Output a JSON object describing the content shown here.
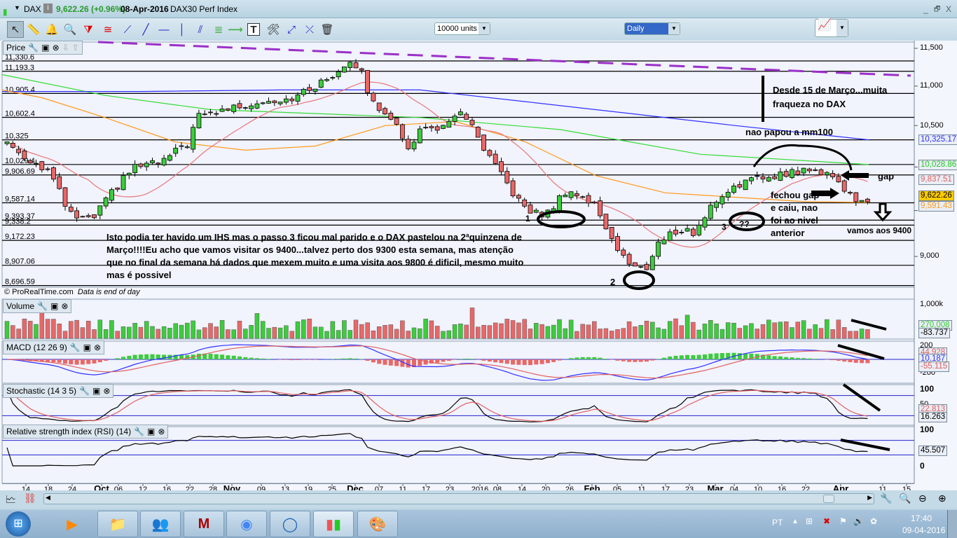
{
  "window": {
    "symbol": "DAX",
    "price": "9,622.26 (+0.96%)",
    "date": "08-Apr-2016",
    "name": "DAX30 Perf Index",
    "min": "_",
    "restore": "🗗",
    "close": "X"
  },
  "toolbar": {
    "units": "10000 units",
    "timeframe": "Daily"
  },
  "price_panel": {
    "title": "Price",
    "footer_brand": "© ProRealTime.com",
    "footer_note": "Data is end of day",
    "levels": [
      "11,330.6",
      "11,193.3",
      "10,905.4",
      "10,602.4",
      "10,325",
      "10,029.4",
      "9,906.69",
      "9,587.14",
      "9,393.37",
      "9,338.2",
      "9,172.23",
      "8,907.06",
      "8,696.59"
    ],
    "axis": [
      "11,500",
      "11,000",
      "10,500",
      "9,000"
    ],
    "badges": [
      {
        "text": "10,325.17",
        "color": "#3030ff"
      },
      {
        "text": "10,028.86",
        "color": "#33dd33"
      },
      {
        "text": "9,837.51",
        "color": "#e06060"
      },
      {
        "text": "9,622.26",
        "color": "#000000"
      },
      {
        "text": "9,591.43",
        "color": "#ff9a1a"
      }
    ]
  },
  "annotations": {
    "main_note": [
      "Isto podia ter havido um IHS mas o passo 3 ficou mal parido e o DAX pastelou na 2ªquinzena de",
      "Março!!!!Eu acho que vamos visitar os 9400...talvez perto dos 9300 esta semana, mas atenção",
      "que no final da semana há dados que mexem muito e uma visita aos 9800 é dificil, mesmo muito",
      "mas é possivel"
    ],
    "weakness": [
      "Desde 15 de Março...muita",
      "fraqueza no DAX"
    ],
    "mm100": "nao papou a mm100",
    "gap": "gap",
    "gap_closed": [
      "fechou gap",
      "e caiu, nao",
      "foi ao nivel",
      "anterior"
    ],
    "target": "vamos aos 9400",
    "step1": "1",
    "step2": "2",
    "step3": "3",
    "question": "??"
  },
  "volume": {
    "title": "Volume",
    "axis": "1,000k",
    "badges": [
      "270,008",
      "-83.737"
    ]
  },
  "macd": {
    "title": "MACD (12 26 9)",
    "axis": [
      "200",
      "-200"
    ],
    "badges": [
      "44.928",
      "10.187",
      "-55.115"
    ]
  },
  "stoch": {
    "title": "Stochastic (14 3 5)",
    "axis": [
      "100",
      "50"
    ],
    "badges": [
      "22.813",
      "16.263"
    ]
  },
  "rsi": {
    "title": "Relative strength index (RSI) (14)",
    "axis": [
      "100",
      "0"
    ],
    "badge": "45.507"
  },
  "xaxis": [
    "14",
    "18",
    "24",
    "Oct",
    "06",
    "12",
    "16",
    "22",
    "28",
    "Nov",
    "09",
    "13",
    "19",
    "25",
    "Dec",
    "07",
    "11",
    "17",
    "23",
    "2016",
    "08",
    "14",
    "20",
    "26",
    "Feb",
    "05",
    "11",
    "17",
    "23",
    "Mar",
    "04",
    "10",
    "16",
    "22",
    "Apr",
    "11",
    "15"
  ],
  "taskbar": {
    "lang": "PT",
    "time": "17:40",
    "date": "09-04-2016"
  },
  "colors": {
    "up": "#3ccc3c",
    "down": "#e86868",
    "ma_red": "#e87878",
    "ma_orange": "#ff9a1a",
    "ma_blue": "#3030ff",
    "ma_green": "#33dd33",
    "trend": "#9b30c8"
  },
  "chart_data": {
    "type": "candlestick",
    "title": "DAX30 Perf Index - Daily",
    "x_range": [
      "Sep 2015",
      "Apr 2016"
    ],
    "y_range": [
      8650,
      11550
    ],
    "close_path": [
      [
        "Sep-10",
        10300
      ],
      [
        "Sep-14",
        10150
      ],
      [
        "Sep-18",
        9950
      ],
      [
        "Sep-24",
        9450
      ],
      [
        "Sep-29",
        9380
      ],
      [
        "Oct-05",
        9700
      ],
      [
        "Oct-09",
        10000
      ],
      [
        "Oct-16",
        10050
      ],
      [
        "Oct-21",
        10300
      ],
      [
        "Oct-22",
        10600
      ],
      [
        "Oct-28",
        10700
      ],
      [
        "Nov-06",
        10800
      ],
      [
        "Nov-13",
        10850
      ],
      [
        "Nov-23",
        11100
      ],
      [
        "Nov-30",
        11350
      ],
      [
        "Dec-01",
        11200
      ],
      [
        "Dec-03",
        10800
      ],
      [
        "Dec-09",
        10600
      ],
      [
        "Dec-14",
        10200
      ],
      [
        "Dec-16",
        10450
      ],
      [
        "Dec-23",
        10500
      ],
      [
        "Dec-29",
        10700
      ],
      [
        "Jan-05",
        10200
      ],
      [
        "Jan-11",
        9850
      ],
      [
        "Jan-15",
        9500
      ],
      [
        "Jan-20",
        9450
      ],
      [
        "Jan-26",
        9750
      ],
      [
        "Feb-01",
        9550
      ],
      [
        "Feb-05",
        9100
      ],
      [
        "Feb-08",
        8900
      ],
      [
        "Feb-11",
        8850
      ],
      [
        "Feb-16",
        9150
      ],
      [
        "Feb-19",
        9300
      ],
      [
        "Feb-24",
        9250
      ],
      [
        "Mar-01",
        9600
      ],
      [
        "Mar-04",
        9800
      ],
      [
        "Mar-10",
        9850
      ],
      [
        "Mar-14",
        9900
      ],
      [
        "Mar-21",
        9950
      ],
      [
        "Mar-29",
        9950
      ],
      [
        "Apr-01",
        9800
      ],
      [
        "Apr-04",
        9650
      ],
      [
        "Apr-08",
        9622.26
      ]
    ]
  }
}
